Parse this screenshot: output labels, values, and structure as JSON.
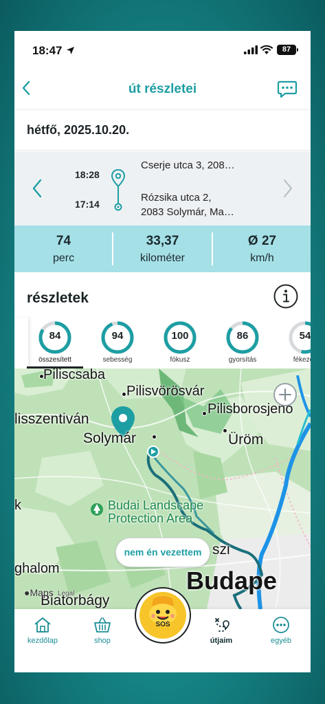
{
  "status_bar": {
    "time": "18:47",
    "battery": "87"
  },
  "header": {
    "title": "út részletei"
  },
  "date": "hétfő, 2025.10.20.",
  "trip": {
    "start_time": "18:28",
    "end_time": "17:14",
    "start_address": "Cserje utca 3, 208…",
    "end_address_line1": "Rózsika utca 2,",
    "end_address_line2": "2083 Solymár, Ma…"
  },
  "stats": [
    {
      "value": "74",
      "label": "perc"
    },
    {
      "value": "33,37",
      "label": "kilométer"
    },
    {
      "value": "Ø 27",
      "label": "km/h"
    }
  ],
  "details": {
    "title": "részletek",
    "scores": [
      {
        "value": "84",
        "label": "összesített",
        "fraction": 0.84,
        "active": true
      },
      {
        "value": "94",
        "label": "sebesség",
        "fraction": 0.94,
        "active": false
      },
      {
        "value": "100",
        "label": "fókusz",
        "fraction": 1.0,
        "active": false
      },
      {
        "value": "86",
        "label": "gyorsítás",
        "fraction": 0.86,
        "active": false
      },
      {
        "value": "54",
        "label": "fékezés",
        "fraction": 0.54,
        "active": false
      }
    ]
  },
  "map": {
    "labels": {
      "piliscsaba": "Piliscsaba",
      "pilisvorosvar": "Pilisvörösvár",
      "pilisborosjeno": "Pilisborosjenő",
      "nagykovacsi_part": "lisszentiván",
      "solymar": "Solymár",
      "urom": "Üröm",
      "park_line1": "Budai Landscape",
      "park_line2": "Protection Area",
      "budakeszi_part": "szi",
      "budaors_part": "ghalom",
      "biatorbagy_part": "Biatorbágy",
      "budapest_part": "Budape",
      "k_part": "k"
    },
    "not_me_button": "nem én vezettem",
    "maps_attribution": "Maps",
    "legal": "Legal"
  },
  "tabbar": {
    "items": [
      {
        "label": "kezdőlap",
        "icon": "home-icon"
      },
      {
        "label": "shop",
        "icon": "basket-icon"
      },
      {
        "label": "útjaim",
        "icon": "route-icon",
        "active": true
      },
      {
        "label": "egyéb",
        "icon": "more-icon"
      }
    ],
    "sos_label": "SOS"
  },
  "colors": {
    "accent": "#1d9ea3",
    "stats_bg": "#a5e0e7",
    "route": "#1a7f8a",
    "sos_yellow": "#f7c52a"
  }
}
